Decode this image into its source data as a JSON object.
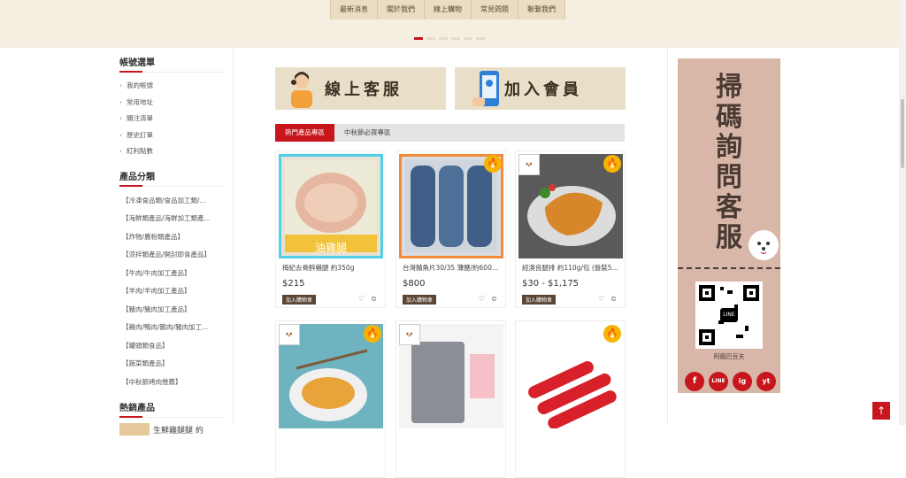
{
  "nav": [
    "最新消息",
    "關於我們",
    "線上購物",
    "常見問題",
    "聯繫我們"
  ],
  "sidebar": {
    "account_title": "帳號選單",
    "account_items": [
      "我的帳號",
      "常用地址",
      "關注清單",
      "歷史訂單",
      "紅利點數"
    ],
    "category_title": "產品分類",
    "categories": [
      "【冷凍食品類/食品加工類/...",
      "【海鮮類產品/海鮮加工類產...",
      "【炸物/農粉類產品】",
      "【涼拌類產品/開封即食產品】",
      "【牛肉/牛肉加工產品】",
      "【羊肉/羊肉加工產品】",
      "【豬肉/豬肉加工產品】",
      "【雞肉/鴨肉/鵝肉/豬肉加工...",
      "【罐頭類食品】",
      "【蔬菜類產品】",
      "【中秋節烤肉推薦】"
    ],
    "hot_title": "熱銷產品",
    "hot_item": "生鮮雞腿腿 約"
  },
  "promos": {
    "service": "線上客服",
    "member": "加入會員"
  },
  "tabs": [
    "熱門產品專區",
    "中秋節必買專區"
  ],
  "products": [
    {
      "name": "梅紀去骨醉雞腿 約350g",
      "price": "$215",
      "img_text": "油雞腿",
      "hot": false
    },
    {
      "name": "台灣鯖魚片30/35 薄鹽/約600...",
      "price": "$800",
      "img_text": "",
      "hot": true
    },
    {
      "name": "紐澳良腿排 約110g/包 (盤裝5...",
      "price": "$30 - $1,175",
      "img_text": "",
      "hot": true
    },
    {
      "name": "",
      "price": "",
      "img_text": "",
      "hot": true
    },
    {
      "name": "",
      "price": "",
      "img_text": "",
      "hot": false
    },
    {
      "name": "",
      "price": "",
      "img_text": "",
      "hot": true
    }
  ],
  "cart_label": "加入購物車",
  "qr": {
    "title": "掃碼詢問客服",
    "caption": "阿鳳巴豆夫",
    "qr_label": "LINE"
  },
  "socials": [
    "f",
    "LINE",
    "ig",
    "yt"
  ],
  "colors": {
    "accent": "#c8161d",
    "beige": "#e9dfc8",
    "panel": "#d8b7a8"
  }
}
